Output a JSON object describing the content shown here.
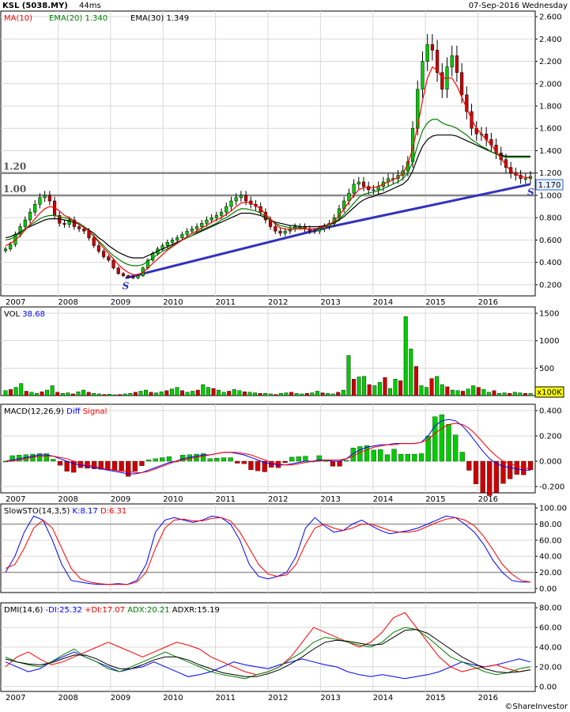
{
  "header": {
    "ticker": "KSL (5038.MY)",
    "timing": "44ms",
    "date": "07-Sep-2016 Wednesday"
  },
  "colors": {
    "ma": "#ff0000",
    "ema20": "#008000",
    "ema30": "#000000",
    "up": "#00cc00",
    "down": "#cc0000",
    "trend": "#3333bb",
    "blue": "#0000ff",
    "red": "#ff0000",
    "green": "#008000",
    "lastBox": "#e8f0ff",
    "unitBox": "#ffff00"
  },
  "years": [
    "2007",
    "2008",
    "2009",
    "2010",
    "2011",
    "2012",
    "2013",
    "2014",
    "2015",
    "2016"
  ],
  "price_panel": {
    "legend": [
      {
        "label": "MA(10)",
        "value": "",
        "color": "#ff0000"
      },
      {
        "label": "EMA(20)",
        "value": "1.340",
        "color": "#008000"
      },
      {
        "label": "EMA(30)",
        "value": "1.349",
        "color": "#000000"
      }
    ],
    "yticks": [
      "2.600",
      "2.400",
      "2.200",
      "2.000",
      "1.800",
      "1.600",
      "1.400",
      "1.200",
      "1.000",
      "0.800",
      "0.600",
      "0.400",
      "0.200"
    ],
    "levels": [
      {
        "value": 1.2,
        "label": "1.20"
      },
      {
        "value": 1.0,
        "label": "1.00"
      }
    ],
    "last": "1.170",
    "sr_label": "S"
  },
  "volume_panel": {
    "legend_label": "VOL",
    "legend_value": "38.68",
    "yticks": [
      "1500",
      "1000",
      "500"
    ],
    "unit": "x100K"
  },
  "macd_panel": {
    "legend_label": "MACD(12,26,9)",
    "diff_label": "Diff",
    "signal_label": "Signal",
    "yticks": [
      "0.400",
      "0.200",
      "0.000",
      "-0.200"
    ]
  },
  "sto_panel": {
    "legend_label": "SlowSTO(14,3,5)",
    "k_label": "K:8.17",
    "d_label": "D:6.31",
    "yticks": [
      "100.00",
      "80.00",
      "60.00",
      "40.00",
      "20.00",
      "0.00"
    ]
  },
  "dmi_panel": {
    "legend_label": "DMI(14,6)",
    "minus_label": "-DI:25.32",
    "plus_label": "+DI:17.07",
    "adx_label": "ADX:20.21",
    "adxr_label": "ADXR:15.19",
    "yticks": [
      "80.00",
      "60.00",
      "40.00",
      "20.00",
      "0.00"
    ]
  },
  "footer": {
    "brand": "©ShareInvestor"
  },
  "chart_data": [
    {
      "type": "candlestick",
      "title": "KSL (5038.MY)",
      "x_start": 2006.9,
      "x_end": 2016.75,
      "ylim": [
        0.1,
        2.65
      ],
      "close": [
        0.52,
        0.56,
        0.65,
        0.72,
        0.78,
        0.85,
        0.92,
        0.98,
        1.0,
        0.95,
        0.82,
        0.75,
        0.74,
        0.78,
        0.72,
        0.7,
        0.68,
        0.62,
        0.55,
        0.5,
        0.45,
        0.42,
        0.35,
        0.3,
        0.28,
        0.27,
        0.26,
        0.28,
        0.35,
        0.42,
        0.48,
        0.52,
        0.55,
        0.58,
        0.6,
        0.62,
        0.65,
        0.68,
        0.7,
        0.72,
        0.75,
        0.78,
        0.8,
        0.82,
        0.85,
        0.9,
        0.95,
        0.98,
        1.0,
        0.95,
        0.92,
        0.9,
        0.85,
        0.78,
        0.72,
        0.68,
        0.66,
        0.68,
        0.7,
        0.72,
        0.72,
        0.7,
        0.68,
        0.68,
        0.7,
        0.72,
        0.75,
        0.8,
        0.88,
        0.95,
        1.02,
        1.1,
        1.12,
        1.08,
        1.05,
        1.05,
        1.08,
        1.12,
        1.15,
        1.15,
        1.18,
        1.22,
        1.3,
        1.6,
        1.95,
        2.2,
        2.35,
        2.3,
        2.1,
        1.95,
        2.15,
        2.25,
        2.1,
        1.9,
        1.75,
        1.6,
        1.55,
        1.55,
        1.5,
        1.45,
        1.38,
        1.32,
        1.25,
        1.2,
        1.18,
        1.15,
        1.15,
        1.17
      ],
      "ma10": [
        0.55,
        0.57,
        0.6,
        0.64,
        0.69,
        0.74,
        0.79,
        0.84,
        0.88,
        0.9,
        0.89,
        0.86,
        0.82,
        0.8,
        0.77,
        0.74,
        0.71,
        0.68,
        0.63,
        0.58,
        0.53,
        0.48,
        0.43,
        0.38,
        0.34,
        0.31,
        0.29,
        0.29,
        0.31,
        0.35,
        0.39,
        0.43,
        0.47,
        0.51,
        0.54,
        0.57,
        0.6,
        0.63,
        0.66,
        0.68,
        0.71,
        0.73,
        0.76,
        0.78,
        0.8,
        0.83,
        0.86,
        0.9,
        0.93,
        0.94,
        0.93,
        0.91,
        0.88,
        0.83,
        0.79,
        0.74,
        0.71,
        0.7,
        0.69,
        0.7,
        0.7,
        0.7,
        0.7,
        0.7,
        0.71,
        0.72,
        0.74,
        0.77,
        0.82,
        0.88,
        0.94,
        1.0,
        1.05,
        1.07,
        1.07,
        1.07,
        1.08,
        1.1,
        1.12,
        1.14,
        1.16,
        1.2,
        1.28,
        1.42,
        1.62,
        1.85,
        2.05,
        2.15,
        2.12,
        2.05,
        2.05,
        2.05,
        1.98,
        1.88,
        1.78,
        1.68,
        1.6,
        1.55,
        1.5,
        1.45,
        1.39,
        1.33,
        1.27,
        1.22,
        1.19,
        1.17,
        1.16,
        1.16
      ],
      "ema20": [
        0.6,
        0.61,
        0.63,
        0.66,
        0.7,
        0.73,
        0.76,
        0.79,
        0.81,
        0.82,
        0.82,
        0.81,
        0.8,
        0.79,
        0.77,
        0.75,
        0.72,
        0.68,
        0.64,
        0.59,
        0.55,
        0.5,
        0.46,
        0.43,
        0.4,
        0.38,
        0.37,
        0.37,
        0.38,
        0.41,
        0.44,
        0.47,
        0.5,
        0.52,
        0.55,
        0.57,
        0.6,
        0.62,
        0.64,
        0.67,
        0.69,
        0.71,
        0.73,
        0.75,
        0.78,
        0.8,
        0.83,
        0.86,
        0.88,
        0.88,
        0.87,
        0.86,
        0.84,
        0.81,
        0.78,
        0.75,
        0.73,
        0.72,
        0.71,
        0.71,
        0.71,
        0.7,
        0.7,
        0.7,
        0.71,
        0.72,
        0.74,
        0.76,
        0.79,
        0.83,
        0.88,
        0.93,
        0.98,
        1.01,
        1.02,
        1.03,
        1.04,
        1.06,
        1.08,
        1.1,
        1.12,
        1.15,
        1.2,
        1.3,
        1.45,
        1.58,
        1.65,
        1.68,
        1.68,
        1.65,
        1.63,
        1.62,
        1.6,
        1.57,
        1.54,
        1.5,
        1.47,
        1.44,
        1.42,
        1.39,
        1.37,
        1.35,
        1.34,
        1.34,
        1.34,
        1.34,
        1.34,
        1.34
      ],
      "ema30": [
        0.62,
        0.63,
        0.65,
        0.67,
        0.7,
        0.72,
        0.74,
        0.76,
        0.78,
        0.79,
        0.79,
        0.79,
        0.78,
        0.77,
        0.76,
        0.74,
        0.72,
        0.69,
        0.66,
        0.62,
        0.59,
        0.55,
        0.52,
        0.49,
        0.47,
        0.45,
        0.44,
        0.44,
        0.44,
        0.46,
        0.48,
        0.5,
        0.52,
        0.54,
        0.56,
        0.58,
        0.6,
        0.62,
        0.64,
        0.66,
        0.68,
        0.7,
        0.72,
        0.74,
        0.76,
        0.78,
        0.8,
        0.82,
        0.84,
        0.84,
        0.84,
        0.83,
        0.82,
        0.8,
        0.78,
        0.76,
        0.75,
        0.74,
        0.73,
        0.73,
        0.72,
        0.72,
        0.72,
        0.72,
        0.72,
        0.73,
        0.74,
        0.75,
        0.78,
        0.81,
        0.85,
        0.89,
        0.93,
        0.96,
        0.98,
        0.99,
        1.01,
        1.02,
        1.04,
        1.06,
        1.08,
        1.1,
        1.14,
        1.22,
        1.34,
        1.44,
        1.5,
        1.53,
        1.54,
        1.54,
        1.54,
        1.54,
        1.53,
        1.51,
        1.49,
        1.47,
        1.45,
        1.43,
        1.41,
        1.39,
        1.37,
        1.36,
        1.35,
        1.35,
        1.35,
        1.35,
        1.35,
        1.35
      ],
      "trendline": [
        {
          "x": 2009.15,
          "y": 0.26
        },
        {
          "x": 2013.0,
          "y": 0.72
        },
        {
          "x": 2016.75,
          "y": 1.1
        }
      ],
      "levels": [
        1.2,
        1.0
      ],
      "last": 1.17
    },
    {
      "type": "bar",
      "title": "VOL",
      "ylim": [
        0,
        1500
      ],
      "values": [
        90,
        110,
        150,
        220,
        80,
        60,
        40,
        70,
        100,
        180,
        60,
        40,
        50,
        30,
        70,
        100,
        60,
        40,
        30,
        20,
        25,
        15,
        20,
        30,
        40,
        60,
        80,
        100,
        60,
        50,
        70,
        90,
        120,
        150,
        90,
        60,
        80,
        100,
        200,
        150,
        130,
        100,
        60,
        80,
        110,
        90,
        70,
        60,
        50,
        40,
        40,
        30,
        20,
        40,
        50,
        60,
        40,
        30,
        40,
        50,
        80,
        50,
        40,
        30,
        60,
        100,
        730,
        300,
        340,
        350,
        200,
        180,
        240,
        330,
        130,
        300,
        270,
        1440,
        850,
        530,
        180,
        150,
        310,
        350,
        200,
        160,
        100,
        90,
        80,
        120,
        180,
        150,
        110,
        60,
        90,
        40,
        50,
        40,
        60,
        50,
        40,
        38.68
      ],
      "last": 38.68
    },
    {
      "type": "bar+line",
      "title": "MACD(12,26,9)",
      "ylim": [
        -0.25,
        0.45
      ],
      "diff": [
        0.0,
        0.01,
        0.02,
        0.03,
        0.04,
        0.05,
        0.05,
        0.04,
        0.02,
        0.0,
        -0.02,
        -0.03,
        -0.04,
        -0.05,
        -0.06,
        -0.07,
        -0.08,
        -0.09,
        -0.1,
        -0.1,
        -0.09,
        -0.07,
        -0.05,
        -0.03,
        -0.01,
        0.0,
        0.02,
        0.03,
        0.04,
        0.05,
        0.05,
        0.06,
        0.07,
        0.07,
        0.06,
        0.05,
        0.03,
        0.01,
        -0.01,
        -0.02,
        -0.03,
        -0.03,
        -0.02,
        -0.01,
        0.0,
        0.0,
        0.01,
        0.01,
        0.0,
        0.0,
        0.02,
        0.06,
        0.09,
        0.11,
        0.12,
        0.13,
        0.13,
        0.14,
        0.14,
        0.14,
        0.14,
        0.15,
        0.2,
        0.28,
        0.32,
        0.33,
        0.32,
        0.28,
        0.22,
        0.15,
        0.08,
        0.02,
        -0.02,
        -0.04,
        -0.05,
        -0.06,
        -0.07,
        -0.07
      ],
      "signal": [
        0.0,
        0.0,
        0.01,
        0.02,
        0.03,
        0.04,
        0.04,
        0.04,
        0.03,
        0.02,
        0.0,
        -0.02,
        -0.03,
        -0.04,
        -0.05,
        -0.06,
        -0.07,
        -0.08,
        -0.08,
        -0.09,
        -0.09,
        -0.08,
        -0.06,
        -0.04,
        -0.02,
        0.0,
        0.01,
        0.02,
        0.03,
        0.04,
        0.05,
        0.06,
        0.07,
        0.07,
        0.07,
        0.06,
        0.05,
        0.03,
        0.01,
        -0.01,
        -0.02,
        -0.03,
        -0.03,
        -0.02,
        -0.01,
        0.0,
        0.0,
        0.01,
        0.01,
        0.01,
        0.02,
        0.04,
        0.07,
        0.09,
        0.11,
        0.12,
        0.13,
        0.13,
        0.14,
        0.14,
        0.14,
        0.15,
        0.17,
        0.22,
        0.26,
        0.29,
        0.3,
        0.29,
        0.26,
        0.21,
        0.15,
        0.09,
        0.04,
        0.0,
        -0.02,
        -0.04,
        -0.05,
        -0.06
      ]
    },
    {
      "type": "line",
      "title": "SlowSTO(14,3,5)",
      "ylim": [
        -5,
        105
      ],
      "k": [
        20,
        40,
        70,
        90,
        85,
        60,
        30,
        10,
        8,
        6,
        5,
        5,
        6,
        5,
        10,
        30,
        70,
        85,
        88,
        85,
        82,
        85,
        90,
        88,
        80,
        60,
        30,
        15,
        12,
        15,
        20,
        40,
        75,
        88,
        78,
        70,
        72,
        80,
        85,
        78,
        72,
        68,
        70,
        72,
        75,
        80,
        85,
        90,
        88,
        80,
        70,
        55,
        35,
        20,
        10,
        8,
        8
      ],
      "d": [
        25,
        30,
        50,
        75,
        85,
        75,
        50,
        25,
        12,
        8,
        6,
        5,
        5,
        5,
        8,
        20,
        50,
        75,
        85,
        86,
        84,
        84,
        87,
        88,
        84,
        70,
        50,
        30,
        18,
        15,
        17,
        30,
        55,
        75,
        80,
        75,
        72,
        75,
        80,
        80,
        76,
        72,
        70,
        70,
        72,
        77,
        82,
        86,
        88,
        85,
        78,
        65,
        48,
        30,
        18,
        10,
        8
      ]
    },
    {
      "type": "line",
      "title": "DMI(14,6)",
      "ylim": [
        -5,
        85
      ],
      "minus_di": [
        25,
        20,
        15,
        18,
        25,
        30,
        35,
        30,
        25,
        20,
        15,
        18,
        20,
        25,
        20,
        15,
        10,
        12,
        15,
        20,
        25,
        22,
        20,
        18,
        22,
        25,
        28,
        25,
        22,
        20,
        15,
        12,
        10,
        12,
        10,
        8,
        10,
        12,
        15,
        20,
        25,
        22,
        20,
        22,
        25,
        28,
        25
      ],
      "plus_di": [
        20,
        30,
        35,
        28,
        22,
        25,
        30,
        35,
        40,
        45,
        40,
        35,
        30,
        35,
        40,
        45,
        42,
        38,
        30,
        25,
        20,
        15,
        12,
        15,
        20,
        30,
        45,
        60,
        55,
        50,
        45,
        40,
        45,
        55,
        70,
        75,
        60,
        45,
        30,
        20,
        15,
        18,
        20,
        22,
        18,
        15,
        17
      ],
      "adx": [
        30,
        25,
        22,
        20,
        25,
        32,
        38,
        30,
        25,
        18,
        15,
        20,
        25,
        30,
        35,
        30,
        25,
        20,
        15,
        12,
        10,
        8,
        12,
        15,
        20,
        28,
        35,
        45,
        50,
        48,
        45,
        42,
        40,
        45,
        55,
        60,
        58,
        50,
        40,
        30,
        25,
        20,
        15,
        12,
        14,
        18,
        20
      ],
      "adxr": [
        28,
        25,
        23,
        22,
        24,
        28,
        32,
        32,
        28,
        22,
        18,
        18,
        22,
        27,
        30,
        30,
        27,
        22,
        18,
        14,
        12,
        10,
        10,
        13,
        17,
        23,
        30,
        38,
        45,
        47,
        46,
        44,
        42,
        43,
        50,
        57,
        58,
        54,
        46,
        38,
        30,
        24,
        18,
        15,
        14,
        15,
        17
      ]
    }
  ]
}
